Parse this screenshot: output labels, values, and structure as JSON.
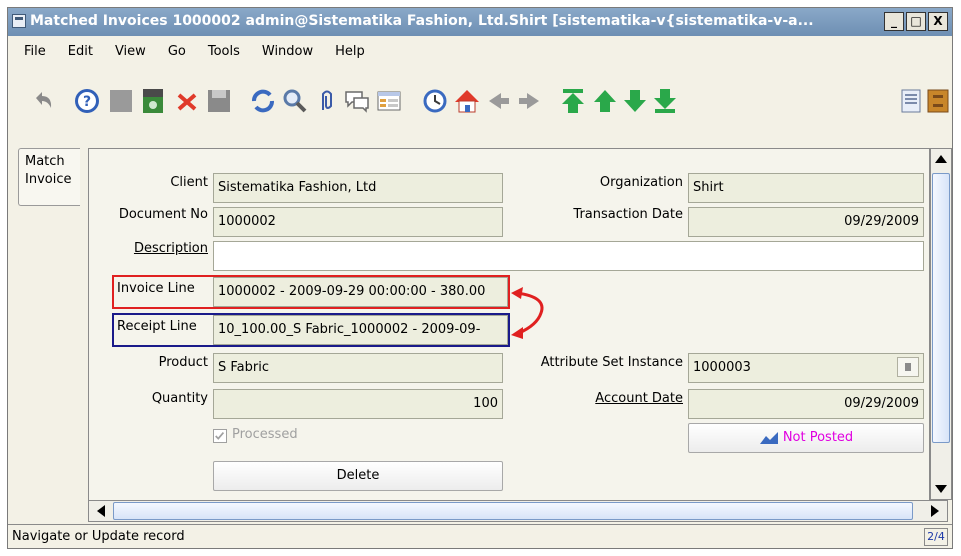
{
  "window": {
    "title": "Matched Invoices  1000002  admin@Sistematika Fashion, Ltd.Shirt [sistematika-v{sistematika-v-a...",
    "minimize_label": "_",
    "maximize_label": "□",
    "close_label": "X"
  },
  "menu": [
    "File",
    "Edit",
    "View",
    "Go",
    "Tools",
    "Window",
    "Help"
  ],
  "toolbar_icons": [
    "undo-icon",
    "help-icon",
    "new-record-icon",
    "copy-record-icon",
    "delete-icon",
    "save-icon",
    "refresh-icon",
    "find-icon",
    "attachment-icon",
    "chat-icon",
    "grid-toggle-icon",
    "history-icon",
    "home-icon",
    "back-icon",
    "forward-icon",
    "first-record-icon",
    "previous-record-icon",
    "next-record-icon",
    "last-record-icon",
    "report-icon",
    "archive-icon"
  ],
  "tab": {
    "label_line1": "Match",
    "label_line2": "Invoice"
  },
  "form": {
    "client": {
      "label": "Client",
      "value": "Sistematika Fashion, Ltd"
    },
    "organization": {
      "label": "Organization",
      "value": "Shirt"
    },
    "document_no": {
      "label": "Document No",
      "value": "1000002"
    },
    "transaction_date": {
      "label": "Transaction Date",
      "value": "09/29/2009"
    },
    "description": {
      "label": "Description",
      "value": ""
    },
    "invoice_line": {
      "label": "Invoice Line",
      "value": "1000002 - 2009-09-29 00:00:00 - 380.00"
    },
    "receipt_line": {
      "label": "Receipt Line",
      "value": "10_100.00_S Fabric_1000002 - 2009-09-"
    },
    "product": {
      "label": "Product",
      "value": "S Fabric"
    },
    "attribute_set_instance": {
      "label": "Attribute Set Instance",
      "value": "1000003"
    },
    "quantity": {
      "label": "Quantity",
      "value": "100"
    },
    "account_date": {
      "label": "Account Date",
      "value": "09/29/2009"
    },
    "processed": {
      "label": "Processed",
      "checked": true
    },
    "posted_button": {
      "label": "Not Posted",
      "color": "#e000e0"
    },
    "delete_button": {
      "label": "Delete"
    }
  },
  "highlight": {
    "invoice_color": "#e02020",
    "receipt_color": "#1a1a8a",
    "arrow_color": "#e02020"
  },
  "status": {
    "message": "Navigate or Update record",
    "count": "2/4"
  }
}
